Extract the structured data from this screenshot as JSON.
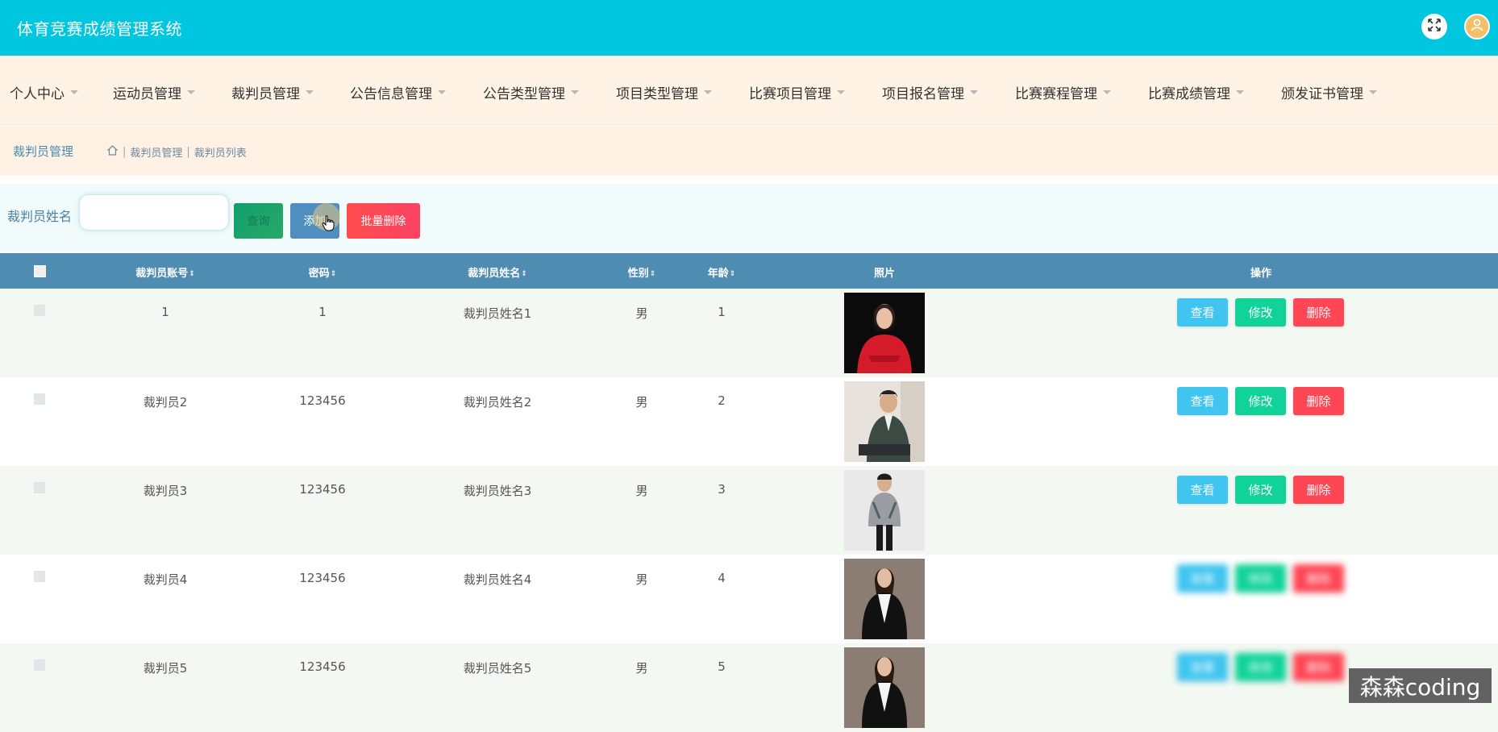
{
  "app": {
    "title": "体育竞赛成绩管理系统"
  },
  "header": {
    "fullscreen_icon": "expand-arrows-icon",
    "avatar_icon": "user-icon"
  },
  "menu": [
    "个人中心",
    "运动员管理",
    "裁判员管理",
    "公告信息管理",
    "公告类型管理",
    "项目类型管理",
    "比赛项目管理",
    "项目报名管理",
    "比赛赛程管理",
    "比赛成绩管理",
    "颁发证书管理"
  ],
  "page": {
    "title": "裁判员管理",
    "breadcrumb": [
      "裁判员管理",
      "裁判员列表"
    ]
  },
  "search": {
    "label": "裁判员姓名",
    "value": "",
    "query_label": "查询",
    "add_label": "添加",
    "batch_delete_label": "批量删除"
  },
  "table": {
    "columns": [
      "裁判员账号",
      "密码",
      "裁判员姓名",
      "性别",
      "年龄",
      "照片",
      "操作"
    ],
    "sortable": [
      true,
      true,
      true,
      true,
      true,
      false,
      false
    ],
    "actions": {
      "view": "查看",
      "edit": "修改",
      "delete": "删除"
    },
    "rows": [
      {
        "account": "1",
        "password": "1",
        "name": "裁判员姓名1",
        "gender": "男",
        "age": "1"
      },
      {
        "account": "裁判员2",
        "password": "123456",
        "name": "裁判员姓名2",
        "gender": "男",
        "age": "2"
      },
      {
        "account": "裁判员3",
        "password": "123456",
        "name": "裁判员姓名3",
        "gender": "男",
        "age": "3"
      },
      {
        "account": "裁判员4",
        "password": "123456",
        "name": "裁判员姓名4",
        "gender": "男",
        "age": "4"
      },
      {
        "account": "裁判员5",
        "password": "123456",
        "name": "裁判员姓名5",
        "gender": "男",
        "age": "5"
      }
    ]
  },
  "watermark": "森森coding",
  "colors": {
    "header": "#00c6e0",
    "menubar": "#fff3e6",
    "table_head": "#4e8cb2",
    "view": "#3fc5f0",
    "edit": "#11d39a",
    "delete": "#ff4655"
  }
}
